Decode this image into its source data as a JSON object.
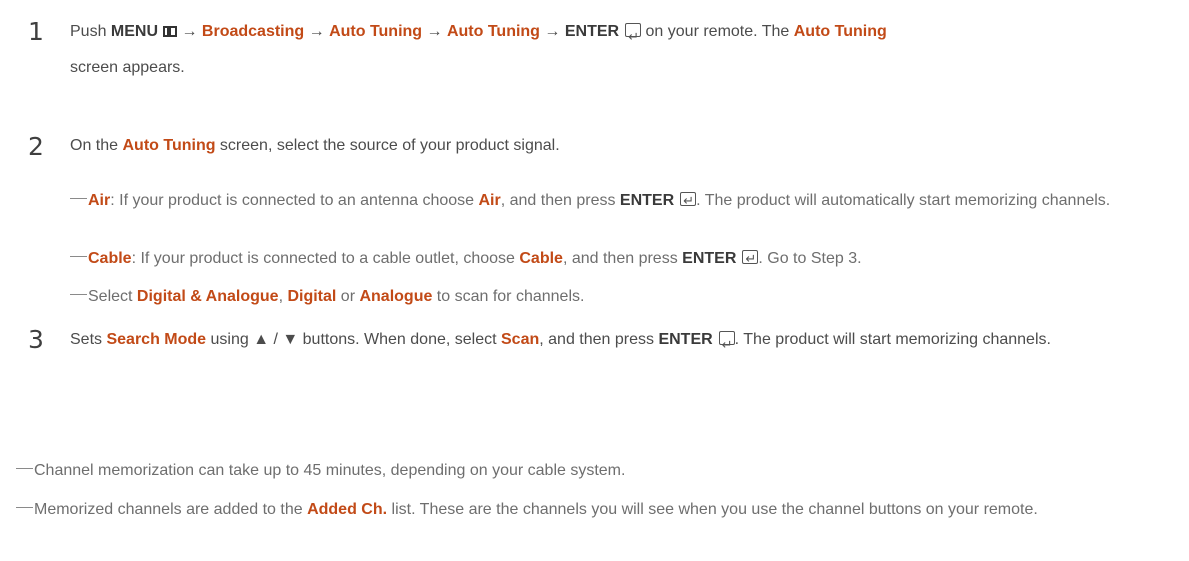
{
  "steps": [
    {
      "number": "1",
      "text": {
        "t1": "Push ",
        "menu": "MENU",
        "arrow1": " → ",
        "broadcasting": "Broadcasting",
        "arrow2": " → ",
        "auto_tuning_1": "Auto Tuning",
        "arrow3": " → ",
        "auto_tuning_2": "Auto Tuning",
        "arrow4": " → ",
        "enter": "ENTER",
        "t2": " on your remote. The ",
        "auto_tuning_3": "Auto Tuning",
        "t3": " screen appears."
      }
    },
    {
      "number": "2",
      "text": {
        "t1": "On the ",
        "auto_tuning": "Auto Tuning",
        "t2": " screen, select the source of your product signal."
      }
    },
    {
      "number": "3",
      "text": {
        "t1": "Sets ",
        "search_mode": "Search Mode",
        "t2": " using ▲ / ▼ buttons. When done, select ",
        "scan": "Scan",
        "t3": ", and then press ",
        "enter": "ENTER",
        "t4": ". The product will start memorizing channels."
      }
    }
  ],
  "step2_notes": [
    {
      "air_1": "Air",
      "t1": ": If your product is connected to an antenna choose ",
      "air_2": "Air",
      "t2": ", and then press ",
      "enter": "ENTER",
      "t3": ". The product will automatically start memorizing channels."
    },
    {
      "cable_1": "Cable",
      "t1": ": If your product is connected to a cable outlet, choose ",
      "cable_2": "Cable",
      "t2": ", and then press ",
      "enter": "ENTER",
      "t3": ". Go to Step 3."
    },
    {
      "t1": "Select ",
      "digital_analogue": "Digital & Analogue",
      "t2": ", ",
      "digital": "Digital",
      "t3": " or ",
      "analogue": "Analogue",
      "t4": " to scan for channels."
    }
  ],
  "footer_notes": [
    {
      "text": "Channel memorization can take up to 45 minutes, depending on your cable system."
    },
    {
      "t1": "Memorized channels are added to the ",
      "added_ch": "Added Ch.",
      "t2": " list. These are the channels you will see when you use the channel buttons on your remote."
    }
  ],
  "colors": {
    "keyword": "#c24a17",
    "body_text": "#4c4c4c",
    "note_text": "#6e6e6e"
  },
  "icons": [
    "menu-icon",
    "enter-icon"
  ]
}
